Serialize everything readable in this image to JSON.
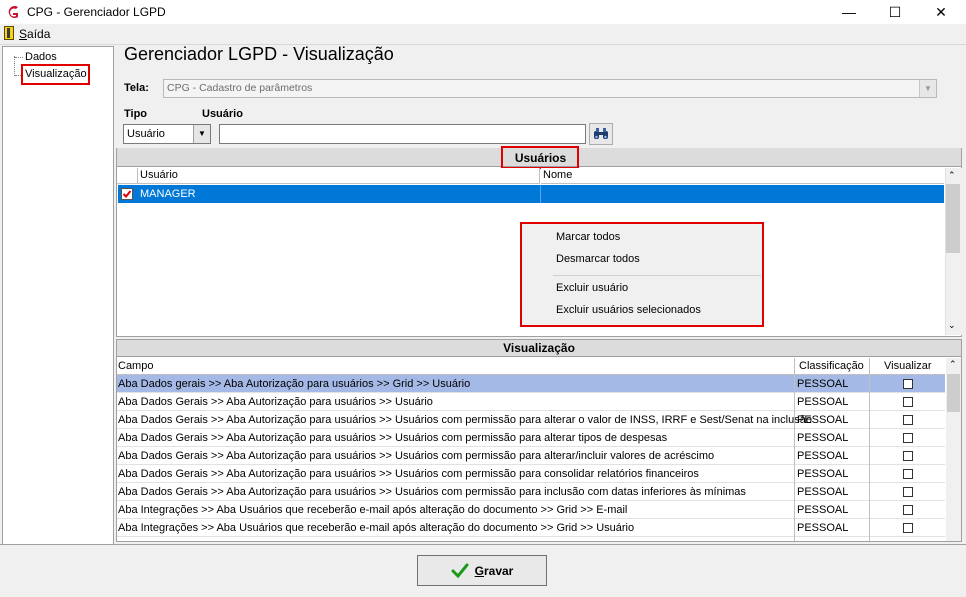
{
  "window": {
    "title": "CPG - Gerenciador LGPD",
    "minimize_glyph": "—",
    "maximize_glyph": "☐",
    "close_glyph": "✕"
  },
  "menu": {
    "exit_label": "Saída",
    "exit_underline": "S",
    "exit_rest": "aída"
  },
  "tree": {
    "items": [
      {
        "label": "Dados"
      },
      {
        "label": "Visualização",
        "highlighted": true
      }
    ]
  },
  "header": {
    "title": "Gerenciador LGPD - Visualização",
    "tela_label": "Tela:",
    "tela_value": "CPG - Cadastro de parâmetros",
    "tipo_label": "Tipo",
    "usuario_label": "Usuário",
    "tipo_value": "Usuário",
    "usuario_value": ""
  },
  "usuarios_panel": {
    "title": "Usuários",
    "columns": [
      "Usuário",
      "Nome"
    ],
    "rows": [
      {
        "checked": true,
        "usuario": "MANAGER",
        "nome": ""
      }
    ]
  },
  "context_menu": {
    "items": [
      "Marcar todos",
      "Desmarcar todos",
      "Excluir usuário",
      "Excluir usuários selecionados"
    ]
  },
  "visualizacao_panel": {
    "title": "Visualização",
    "columns": [
      "Campo",
      "Classificação",
      "Visualizar"
    ],
    "rows": [
      {
        "campo": "Aba Dados gerais >> Aba Autorização para usuários >> Grid >> Usuário",
        "classificacao": "PESSOAL",
        "visualizar": false,
        "selected": true
      },
      {
        "campo": "Aba Dados Gerais >> Aba Autorização para usuários >> Usuário",
        "classificacao": "PESSOAL",
        "visualizar": false
      },
      {
        "campo": "Aba Dados Gerais >> Aba Autorização para usuários >> Usuários com permissão para alterar o valor de INSS, IRRF e Sest/Senat na inclusão",
        "classificacao": "PESSOAL",
        "visualizar": false
      },
      {
        "campo": "Aba Dados Gerais >> Aba Autorização para usuários >> Usuários com permissão para alterar tipos de despesas",
        "classificacao": "PESSOAL",
        "visualizar": false
      },
      {
        "campo": "Aba Dados Gerais >> Aba Autorização para usuários >> Usuários com permissão para alterar/incluir valores de acréscimo",
        "classificacao": "PESSOAL",
        "visualizar": false
      },
      {
        "campo": "Aba Dados Gerais >> Aba Autorização para usuários >> Usuários com permissão para consolidar relatórios financeiros",
        "classificacao": "PESSOAL",
        "visualizar": false
      },
      {
        "campo": "Aba Dados Gerais >> Aba Autorização para usuários >> Usuários com permissão para inclusão com datas inferiores às mínimas",
        "classificacao": "PESSOAL",
        "visualizar": false
      },
      {
        "campo": "Aba Integrações  >> Aba Usuários que receberão e-mail após alteração do documento >> Grid >> E-mail",
        "classificacao": "PESSOAL",
        "visualizar": false
      },
      {
        "campo": "Aba Integrações  >> Aba Usuários que receberão e-mail após alteração do documento >> Grid >> Usuário",
        "classificacao": "PESSOAL",
        "visualizar": false
      }
    ]
  },
  "footer": {
    "save_label": "Gravar",
    "save_underline": "G",
    "save_rest": "ravar"
  },
  "colors": {
    "selection_blue": "#0078d7",
    "row_highlight": "#a5b9e6",
    "annotation_red": "#e00000",
    "check_green": "#1a9a1a"
  }
}
